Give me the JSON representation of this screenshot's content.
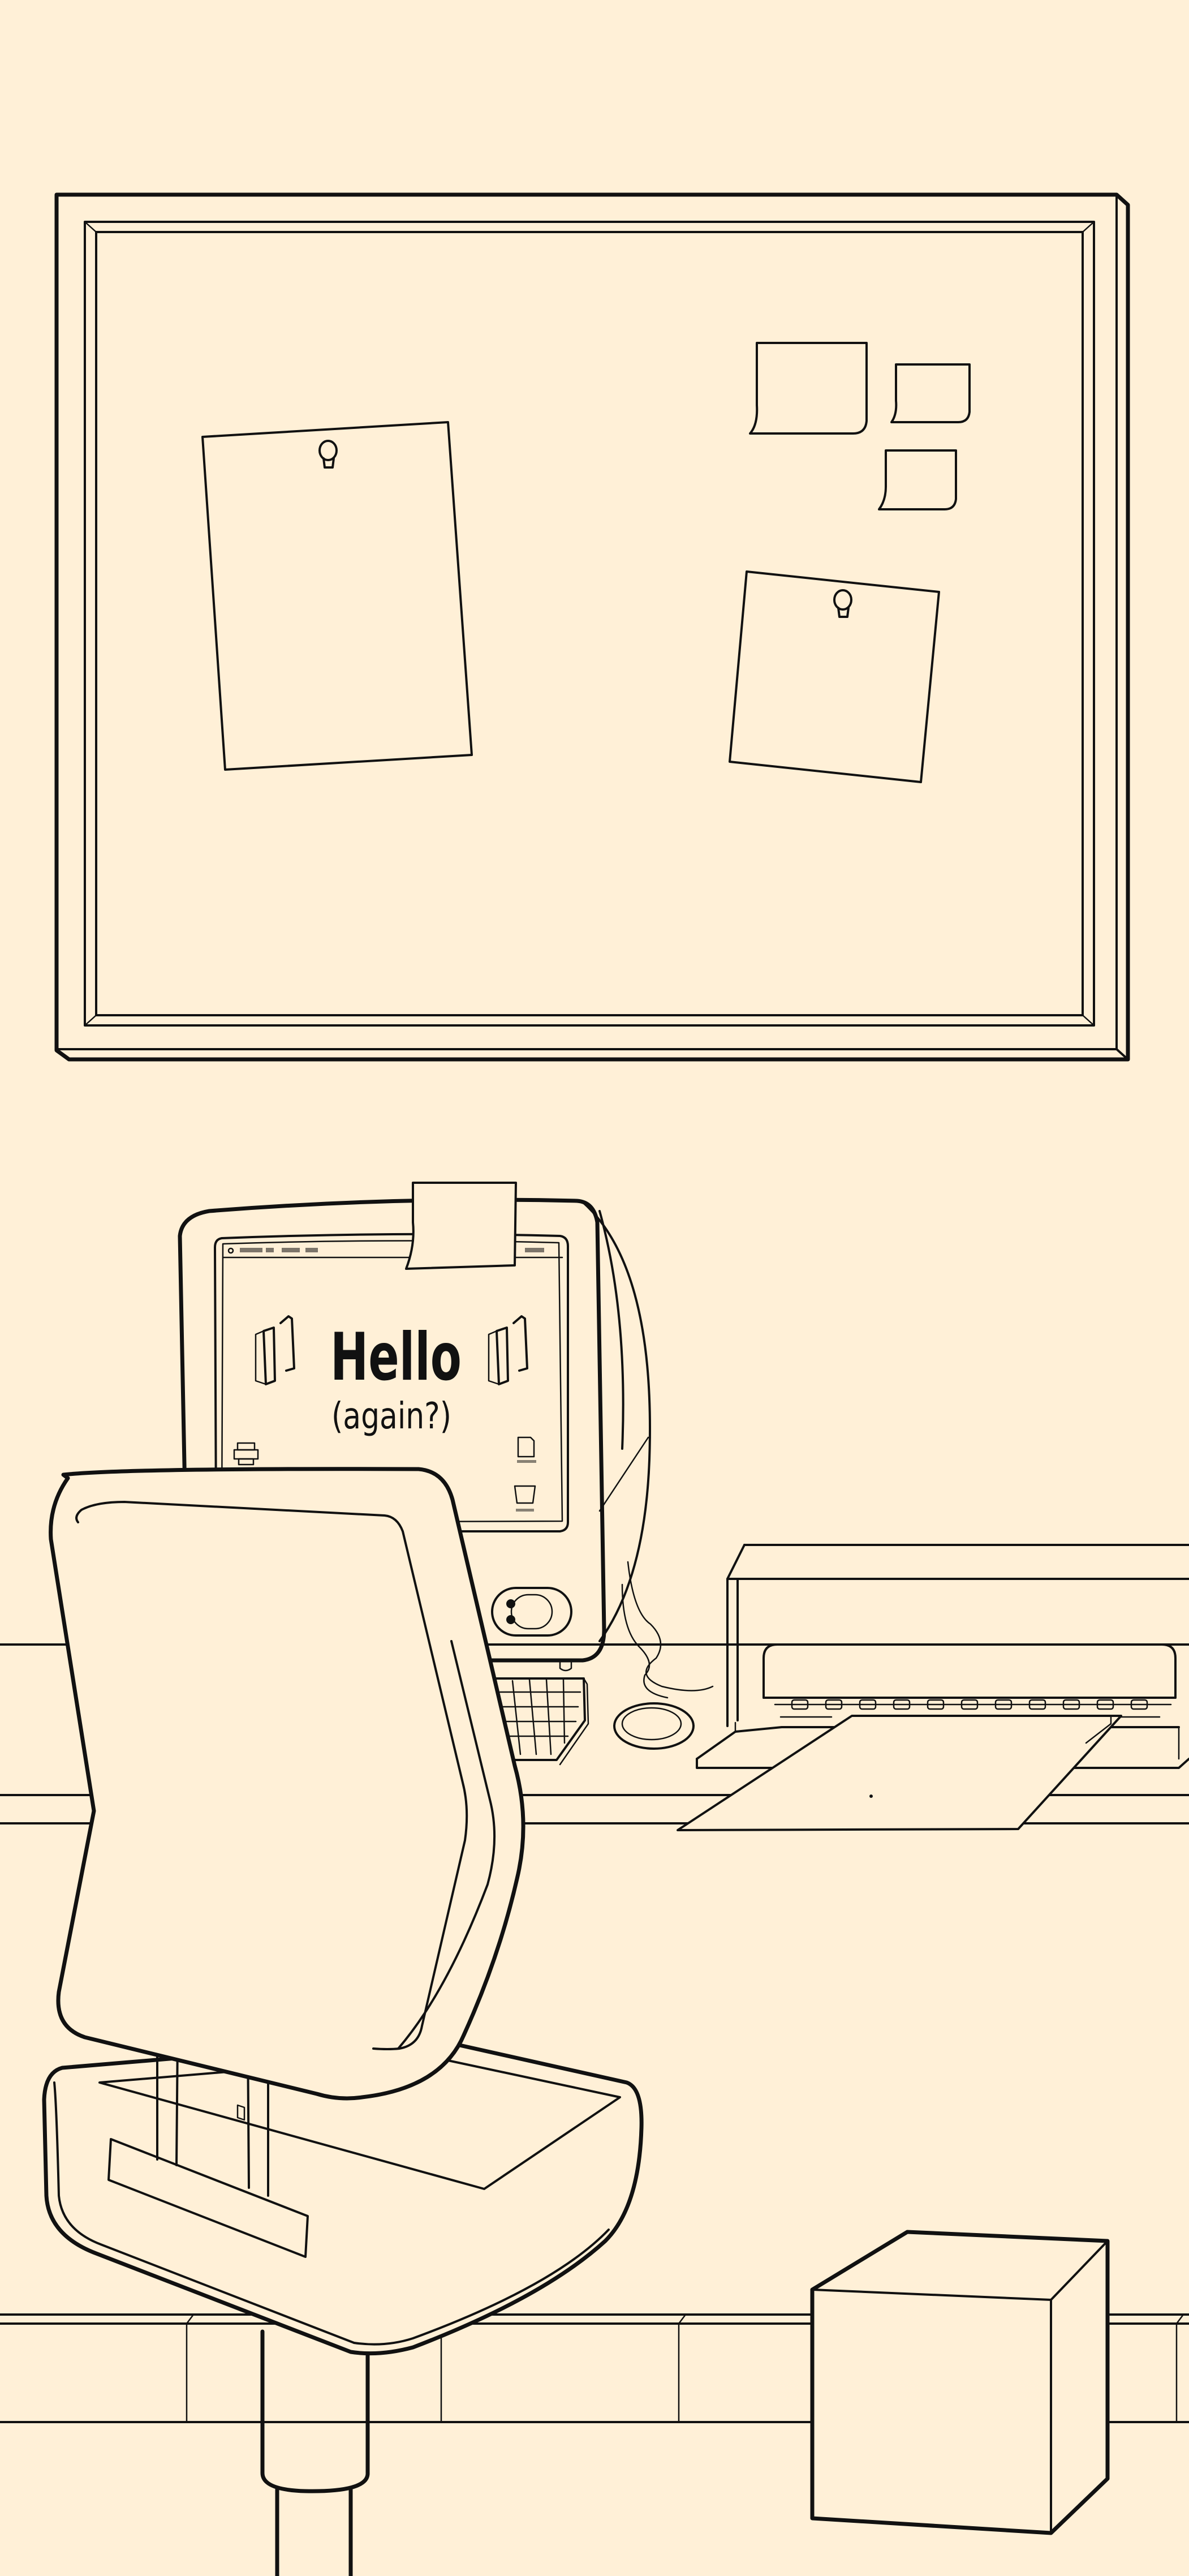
{
  "colors": {
    "background": "#fff0d7",
    "line": "#111111"
  },
  "icons": [
    "apple-logo-icon",
    "printer-icon",
    "document-file-icon",
    "trash-can-icon",
    "speaker-grille-icon",
    "push-pin-icon",
    "sticky-note-icon"
  ],
  "computer": {
    "screen": {
      "headline": "Hello",
      "subheadline": "(again?)"
    }
  }
}
